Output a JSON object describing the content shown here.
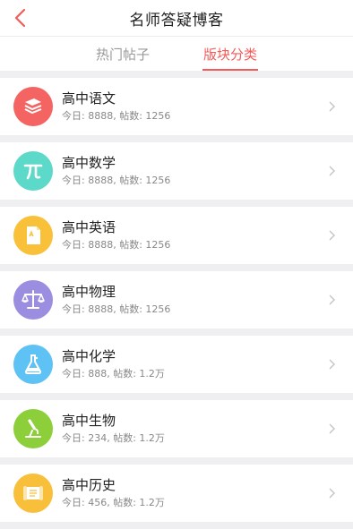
{
  "header": {
    "title": "名师答疑博客"
  },
  "tabs": [
    {
      "label": "热门帖子",
      "active": false
    },
    {
      "label": "版块分类",
      "active": true
    }
  ],
  "colors": {
    "accent": "#f25b59"
  },
  "categories": [
    {
      "name": "高中语文",
      "today": "今日: 8888",
      "posts": "帖数: 1256",
      "icon": "books-icon",
      "color": "#f36462"
    },
    {
      "name": "高中数学",
      "today": "今日: 8888",
      "posts": "帖数: 1256",
      "icon": "pi-icon",
      "color": "#5dd9c9"
    },
    {
      "name": "高中英语",
      "today": "今日: 8888",
      "posts": "帖数: 1256",
      "icon": "document-icon",
      "color": "#f9c139"
    },
    {
      "name": "高中物理",
      "today": "今日: 8888",
      "posts": "帖数: 1256",
      "icon": "scale-icon",
      "color": "#9b8ee0"
    },
    {
      "name": "高中化学",
      "today": "今日: 888",
      "posts": "帖数: 1.2万",
      "icon": "flask-icon",
      "color": "#5ec3f4"
    },
    {
      "name": "高中生物",
      "today": "今日: 234",
      "posts": "帖数: 1.2万",
      "icon": "microscope-icon",
      "color": "#8ccf3a"
    },
    {
      "name": "高中历史",
      "today": "今日: 456",
      "posts": "帖数: 1.2万",
      "icon": "scroll-icon",
      "color": "#f8bf3a"
    }
  ]
}
